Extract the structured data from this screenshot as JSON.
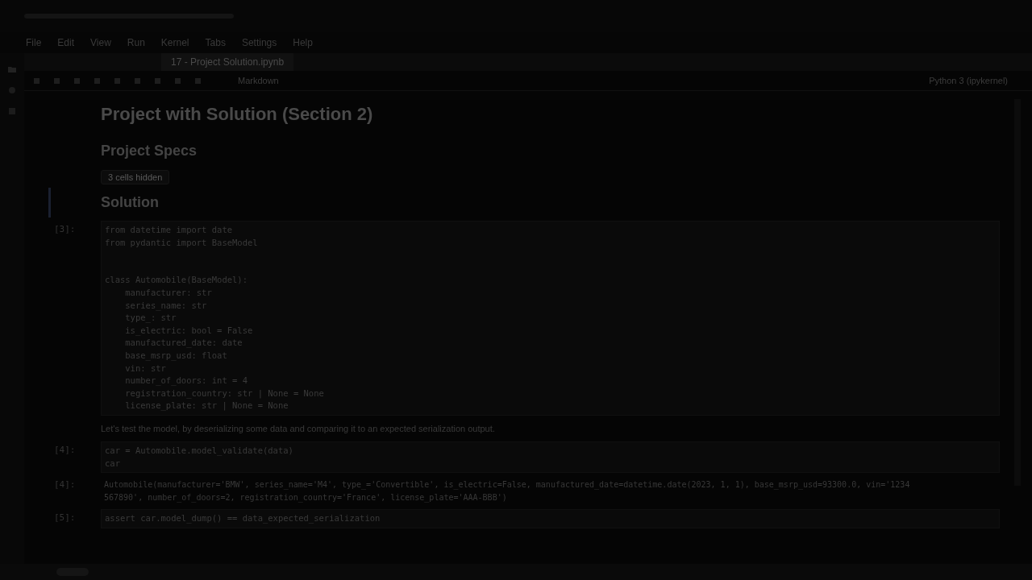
{
  "menu": [
    "File",
    "Edit",
    "View",
    "Run",
    "Kernel",
    "Tabs",
    "Settings",
    "Help"
  ],
  "tab": {
    "title": "17 - Project Solution.ipynb",
    "selected": true
  },
  "toolbar": {
    "cell_type": "Markdown",
    "kernel": "Python 3 (ipykernel)"
  },
  "cells": [
    {
      "kind": "h1",
      "text": "Project with Solution (Section 2)"
    },
    {
      "kind": "h2",
      "text": "Project Specs"
    },
    {
      "kind": "hidden",
      "text": "3 cells hidden"
    },
    {
      "kind": "h2",
      "text": "Solution",
      "active": true
    },
    {
      "kind": "code",
      "prompt": "[3]:",
      "blocks": [
        [
          "from datetime import date",
          "from pydantic import BaseModel"
        ],
        [
          "class Automobile(BaseModel):",
          "    manufacturer: str",
          "    series_name: str",
          "    type_: str",
          "    is_electric: bool = False",
          "    manufactured_date: date",
          "    base_msrp_usd: float",
          "    vin: str",
          "    number_of_doors: int = 4",
          "    registration_country: str | None = None",
          "    license_plate: str | None = None"
        ]
      ]
    },
    {
      "kind": "markdown",
      "text": "Let's test the model, by deserializing some data and comparing it to an expected serialization output."
    },
    {
      "kind": "code",
      "prompt": "[4]:",
      "lines": [
        "car = Automobile.model_validate(data)",
        "car"
      ]
    },
    {
      "kind": "output",
      "prompt": "[4]:",
      "lines": [
        "Automobile(manufacturer='BMW', series_name='M4', type_='Convertible', is_electric=False, manufactured_date=datetime.date(2023, 1, 1), base_msrp_usd=93300.0, vin='1234",
        "567890', number_of_doors=2, registration_country='France', license_plate='AAA-BBB')"
      ]
    },
    {
      "kind": "code",
      "prompt": "[5]:",
      "lines": [
        "assert car.model_dump() == data_expected_serialization"
      ]
    }
  ]
}
